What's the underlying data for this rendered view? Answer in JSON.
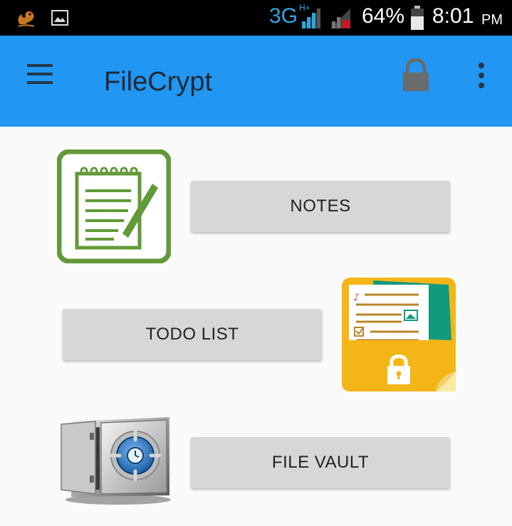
{
  "status_bar": {
    "network": "3G",
    "network_sup": "H+",
    "battery": "64%",
    "time": "8:01",
    "ampm": "PM"
  },
  "app_bar": {
    "title": "FileCrypt"
  },
  "main": {
    "items": [
      {
        "label": "NOTES",
        "icon": "notepad-icon"
      },
      {
        "label": "TODO LIST",
        "icon": "locked-folder-icon"
      },
      {
        "label": "FILE VAULT",
        "icon": "safe-icon"
      }
    ]
  },
  "colors": {
    "app_bar": "#2196f3",
    "status_bar": "#000000",
    "button": "#d6d7d7",
    "notes_green": "#629a38",
    "folder_yellow": "#f4b617",
    "folder_teal": "#129a7f"
  }
}
